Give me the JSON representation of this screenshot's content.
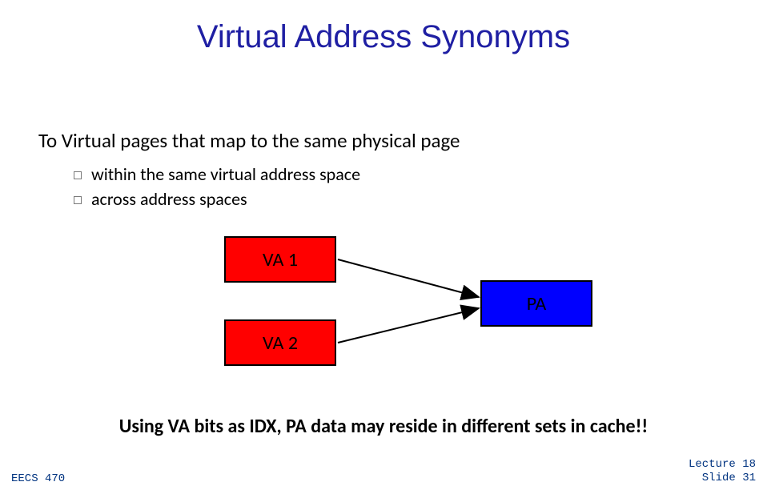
{
  "title": "Virtual Address Synonyms",
  "intro": "To Virtual pages that map to the same physical page",
  "bullets": {
    "b0": "within the same virtual address space",
    "b1": "across address spaces"
  },
  "boxes": {
    "va1": "VA 1",
    "va2": "VA 2",
    "pa": "PA"
  },
  "caption": "Using VA bits as IDX, PA data may reside in different sets in cache!!",
  "footer": {
    "course": "EECS 470",
    "lecture": "Lecture 18",
    "slide": "Slide 31"
  }
}
